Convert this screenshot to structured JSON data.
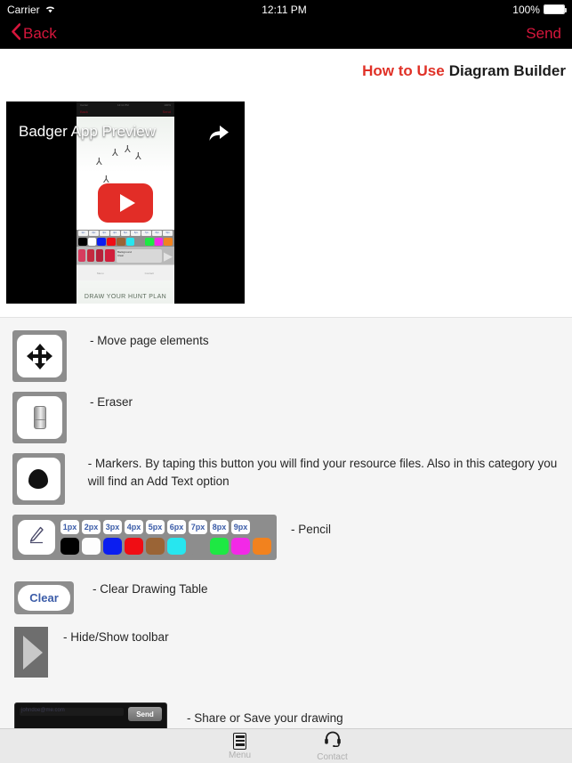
{
  "status_bar": {
    "carrier": "Carrier",
    "wifi_icon": "wifi-icon",
    "time": "12:11 PM",
    "battery_percent": "100%",
    "battery_icon": "battery-full-icon"
  },
  "nav_bar": {
    "back_label": "Back",
    "back_chevron": "‹",
    "send_label": "Send",
    "accent_color": "#d6163c",
    "background_color": "#000000"
  },
  "page_title": {
    "highlight": "How to Use",
    "rest": "Diagram Builder",
    "highlight_color": "#e03127",
    "rest_color": "#1d1d1d"
  },
  "video": {
    "title": "Badger App Preview",
    "share_icon": "share-arrow-icon",
    "play_icon": "youtube-play-icon",
    "play_color": "#e22d27",
    "caption": "DRAW YOUR HUNT PLAN",
    "preview_tool_sizes": [
      "1px",
      "2px",
      "3px",
      "4px",
      "5px",
      "6px",
      "7px",
      "8px",
      "9px"
    ],
    "preview_colors": [
      "#000000",
      "#ffffff",
      "#0b1ef0",
      "#f00d14",
      "#9a6436",
      "#27e6ef",
      "#8d8d8d",
      "#1ee843",
      "#f229e7",
      "#f2821e"
    ],
    "preview_clear_label": "Clear",
    "preview_background_label": "Background",
    "preview_tabs": [
      "Menu",
      "Contact"
    ]
  },
  "instructions": [
    {
      "icon": "move-icon",
      "text": "- Move page elements"
    },
    {
      "icon": "eraser-icon",
      "text": "- Eraser"
    },
    {
      "icon": "marker-icon",
      "text": "- Markers. By taping this button you will find your resource files. Also in this category you will find an Add Text option"
    },
    {
      "icon": "pencil-icon",
      "text": "- Pencil"
    },
    {
      "icon": "clear-icon",
      "text": "- Clear Drawing Table"
    },
    {
      "icon": "toolbar-toggle-icon",
      "text": "- Hide/Show toolbar"
    },
    {
      "icon": "send-bar-icon",
      "text": "- Share or Save your drawing"
    }
  ],
  "palette": {
    "pencil_glyph": "✎",
    "sizes": [
      "1px",
      "2px",
      "3px",
      "4px",
      "5px",
      "6px",
      "7px",
      "8px",
      "9px"
    ],
    "size_text_color": "#3b5ca8",
    "colors": [
      "#000000",
      "#fdfdfd",
      "#0b1ef0",
      "#f00d14",
      "#9a6436",
      "#27e6ef",
      "#8d8d8d",
      "#1ee843",
      "#f229e7",
      "#f2821e"
    ],
    "strip_background": "#8d8d8d"
  },
  "clear_button": {
    "label": "Clear",
    "label_color": "#3b5ca8"
  },
  "send_bar": {
    "button_label": "Send",
    "field_placeholder": "johndoe@me.com"
  },
  "tab_bar": {
    "items": [
      {
        "label": "Menu",
        "icon": "menu-list-icon"
      },
      {
        "label": "Contact",
        "icon": "headset-icon"
      }
    ],
    "label_color": "#b0b0b0",
    "background_color": "#e9e9e9"
  }
}
